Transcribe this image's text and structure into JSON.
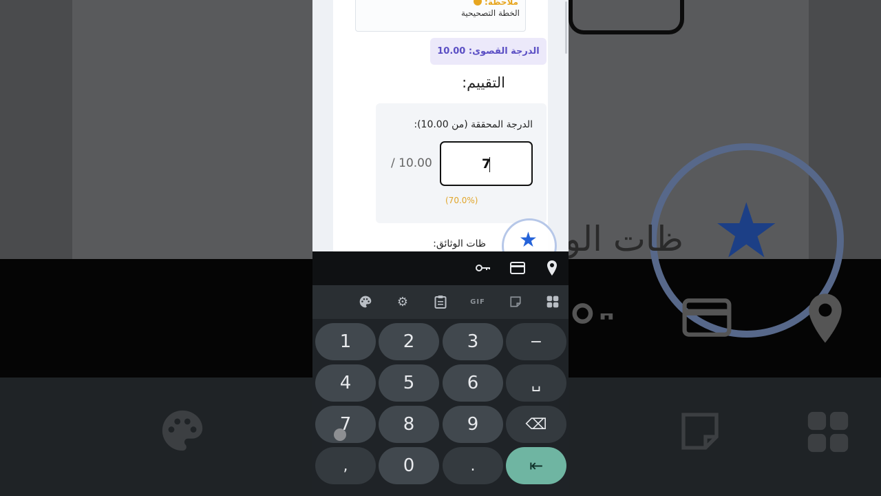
{
  "note": {
    "heading": "ملاحظة:",
    "body": "الخطة التصحيحية"
  },
  "max_grade": "الدرجة القصوى: 10.00",
  "section_title": "التقييم:",
  "grade": {
    "label": "الدرجة المحققة (من 10.00):",
    "value": "7",
    "out_of": "/ 10.00",
    "percent": "(70.0%)"
  },
  "docs_label": "ظات الوثائق:",
  "background": {
    "text": "ظات الو"
  },
  "keyboard": {
    "autofill_icons": [
      "key-icon",
      "credit-card-icon",
      "location-pin-icon"
    ],
    "toolbar_icons": [
      "palette-icon",
      "gear-icon",
      "clipboard-icon",
      "gif-icon",
      "sticker-icon",
      "grid-icon"
    ],
    "gif_label": "GIF",
    "keys": {
      "k1": "1",
      "k2": "2",
      "k3": "3",
      "minus": "−",
      "k4": "4",
      "k5": "5",
      "k6": "6",
      "space": "␣",
      "k7": "7",
      "k8": "8",
      "k9": "9",
      "backspace": "⌫",
      "comma": ",",
      "k0": "0",
      "period": ".",
      "enter": "⇤"
    }
  },
  "colors": {
    "accent_star": "#2563d9",
    "max_badge_text": "#5b4fc4",
    "percent_text": "#e1a52a",
    "enter_key": "#6fb5a2"
  }
}
